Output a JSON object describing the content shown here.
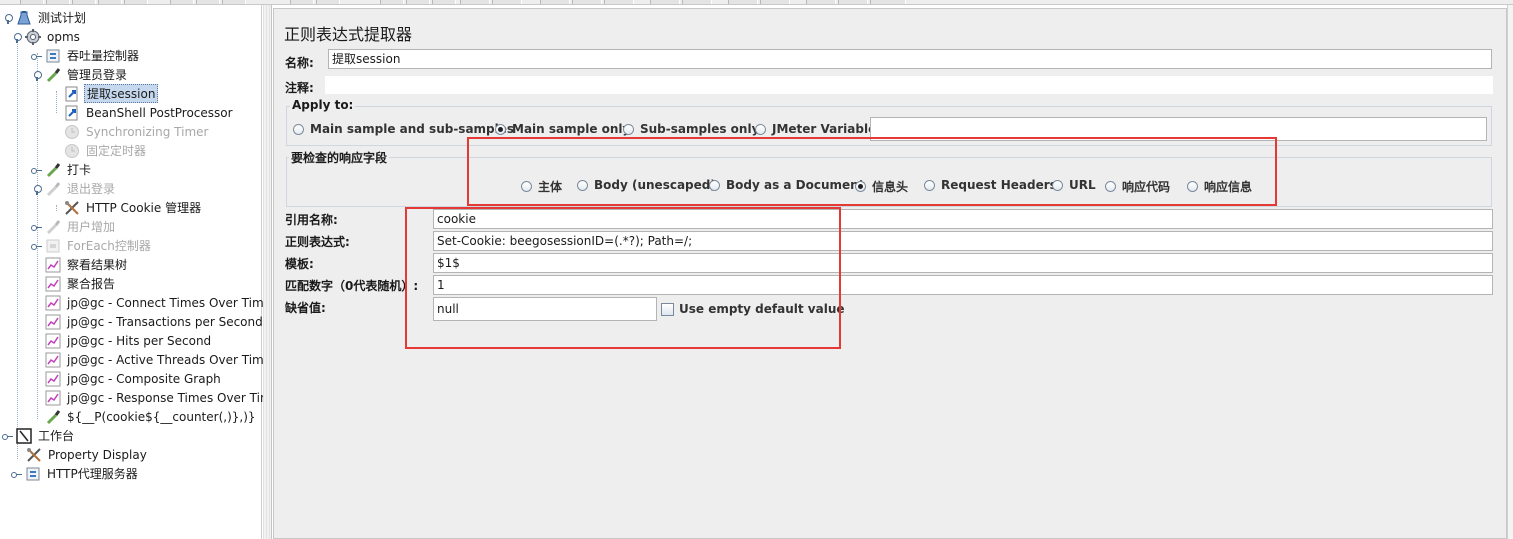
{
  "tree": {
    "items": [
      {
        "label": "测试计划",
        "icon": "test-plan-icon"
      },
      {
        "label": "opms",
        "icon": "thread-group-gear-icon"
      },
      {
        "label": "吞吐量控制器",
        "icon": "throughput-controller-icon"
      },
      {
        "label": "管理员登录",
        "icon": "sampler-pipette-icon"
      },
      {
        "label": "提取session",
        "icon": "extractor-arrow-icon"
      },
      {
        "label": "BeanShell PostProcessor",
        "icon": "postprocessor-arrow-icon"
      },
      {
        "label": "Synchronizing Timer",
        "icon": "timer-clock-icon"
      },
      {
        "label": "固定定时器",
        "icon": "timer-clock-icon"
      },
      {
        "label": "打卡",
        "icon": "sampler-pipette-icon"
      },
      {
        "label": "退出登录",
        "icon": "sampler-pipette-icon"
      },
      {
        "label": "HTTP Cookie 管理器",
        "icon": "config-tools-icon"
      },
      {
        "label": "用户增加",
        "icon": "sampler-pipette-icon"
      },
      {
        "label": "ForEach控制器",
        "icon": "foreach-controller-icon"
      },
      {
        "label": "察看结果树",
        "icon": "listener-graph-icon"
      },
      {
        "label": "聚合报告",
        "icon": "listener-graph-icon"
      },
      {
        "label": "jp@gc - Connect Times Over Time",
        "icon": "listener-graph-icon"
      },
      {
        "label": "jp@gc - Transactions per Second",
        "icon": "listener-graph-icon"
      },
      {
        "label": "jp@gc - Hits per Second",
        "icon": "listener-graph-icon"
      },
      {
        "label": "jp@gc - Active Threads Over Time",
        "icon": "listener-graph-icon"
      },
      {
        "label": "jp@gc - Composite Graph",
        "icon": "listener-graph-icon"
      },
      {
        "label": "jp@gc - Response Times Over Tim",
        "icon": "listener-graph-icon"
      },
      {
        "label": "${__P(cookie${__counter(,)},)}",
        "icon": "sampler-pipette-icon"
      },
      {
        "label": "工作台",
        "icon": "workbench-icon"
      },
      {
        "label": "Property Display",
        "icon": "config-tools-icon"
      },
      {
        "label": "HTTP代理服务器",
        "icon": "proxy-server-icon"
      }
    ]
  },
  "panel": {
    "title": "正则表达式提取器",
    "name_label": "名称:",
    "name_value": "提取session",
    "comment_label": "注释:",
    "comment_value": "",
    "apply_to": {
      "title": "Apply to:",
      "options": [
        "Main sample and sub-samples",
        "Main sample only",
        "Sub-samples only",
        "JMeter Variable"
      ],
      "selected": "Main sample only",
      "variable_value": ""
    },
    "field_to_check": {
      "title": "要检查的响应字段",
      "options": [
        "主体",
        "Body (unescaped)",
        "Body as a Document",
        "信息头",
        "Request Headers",
        "URL",
        "响应代码",
        "响应信息"
      ],
      "selected": "信息头"
    },
    "ref_name_label": "引用名称:",
    "ref_name_value": "cookie",
    "regex_label": "正则表达式:",
    "regex_value": "Set-Cookie: beegosessionID=(.*?); Path=/;",
    "template_label": "模板:",
    "template_value": "$1$",
    "match_no_label": "匹配数字（0代表随机）:",
    "match_no_value": "1",
    "default_label": "缺省值:",
    "default_value": "null",
    "use_empty_label": "Use empty default value"
  },
  "colors": {
    "highlight_box": "#e53935",
    "selection": "#c6d8ee",
    "panel_bg": "#eeeeee"
  }
}
